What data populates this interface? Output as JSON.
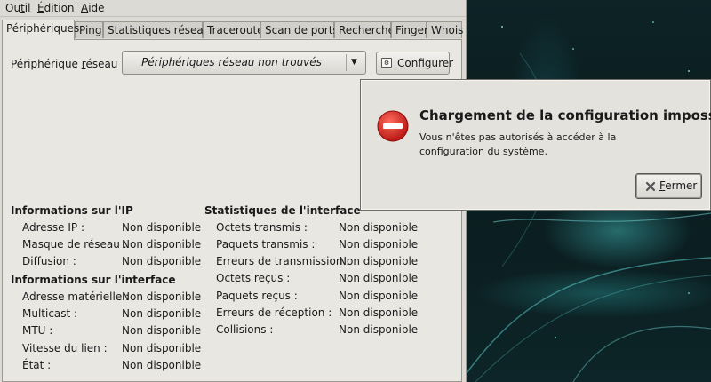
{
  "menubar": {
    "items": [
      {
        "pre": "Ou",
        "ul": "t",
        "post": "il"
      },
      {
        "pre": "",
        "ul": "É",
        "post": "dition"
      },
      {
        "pre": "",
        "ul": "A",
        "post": "ide"
      }
    ]
  },
  "tabs": [
    "Périphériques",
    "Ping",
    "Statistiques réseau",
    "Traceroute",
    "Scan de ports",
    "Recherche",
    "Finger",
    "Whois"
  ],
  "active_tab": "Périphériques",
  "device": {
    "label_pre": "Périphérique ",
    "label_ul": "r",
    "label_post": "éseau :",
    "combo_value": "Périphériques réseau non trouvés",
    "configure_pre": "",
    "configure_ul": "C",
    "configure_post": "onfigurer"
  },
  "ip_info": {
    "title": "Informations sur l'IP",
    "rows": [
      {
        "label": "Adresse IP :",
        "value": "Non disponible"
      },
      {
        "label": "Masque de réseau :",
        "value": "Non disponible"
      },
      {
        "label": "Diffusion :",
        "value": "Non disponible"
      }
    ]
  },
  "interface_info": {
    "title": "Informations sur l'interface",
    "rows": [
      {
        "label": "Adresse matérielle :",
        "value": "Non disponible"
      },
      {
        "label": "Multicast :",
        "value": "Non disponible"
      },
      {
        "label": "MTU :",
        "value": "Non disponible"
      },
      {
        "label": "Vitesse du lien :",
        "value": "Non disponible"
      },
      {
        "label": "État :",
        "value": "Non disponible"
      }
    ]
  },
  "interface_stats": {
    "title": "Statistiques de l'interface",
    "rows": [
      {
        "label": "Octets transmis :",
        "value": "Non disponible"
      },
      {
        "label": "Paquets transmis :",
        "value": "Non disponible"
      },
      {
        "label": "Erreurs de transmission :",
        "value": "Non disponible"
      },
      {
        "label": "Octets reçus :",
        "value": "Non disponible"
      },
      {
        "label": "Paquets reçus :",
        "value": "Non disponible"
      },
      {
        "label": "Erreurs de réception :",
        "value": "Non disponible"
      },
      {
        "label": "Collisions :",
        "value": "Non disponible"
      }
    ]
  },
  "error_dialog": {
    "title": "Chargement de la configuration impossible",
    "message_line1": "Vous n'êtes pas autorisés à accéder à la",
    "message_line2": "configuration du système.",
    "close_pre": "",
    "close_ul": "F",
    "close_post": "ermer",
    "icon": "error-icon"
  },
  "colors": {
    "error_red": "#cc1f1a",
    "window_bg": "#dcdad5",
    "desktop_teal": "#2a8f8f"
  }
}
